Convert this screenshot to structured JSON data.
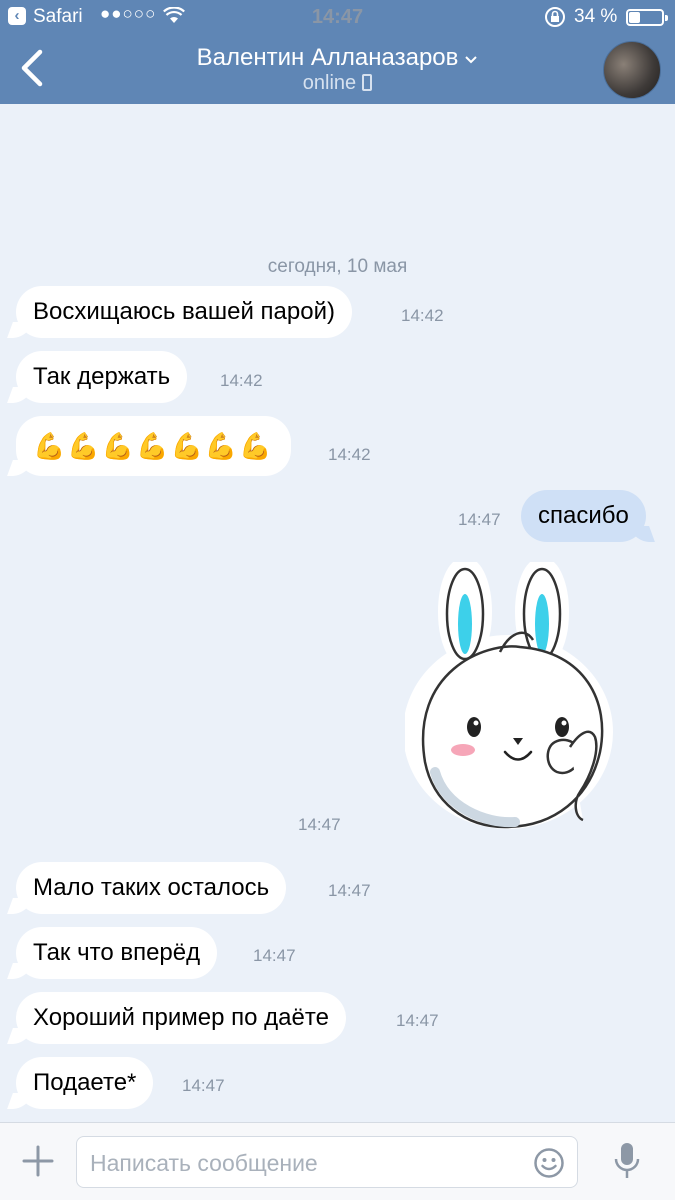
{
  "status_bar": {
    "back_app": "Safari",
    "signal": "●●○○○",
    "time": "14:47",
    "battery_percent": "34 %",
    "battery_level": 0.34
  },
  "header": {
    "back_icon": "chevron-left-icon",
    "title": "Валентин Алланазаров",
    "subtitle": "online",
    "title_chevron": "chevron-down-icon",
    "avatar_icon": "avatar"
  },
  "chat": {
    "date_separator": "сегодня, 10 мая",
    "messages": [
      {
        "text": "Восхищаюсь вашей парой)",
        "time": "14:42",
        "direction": "in"
      },
      {
        "text": "Так держать",
        "time": "14:42",
        "direction": "in"
      },
      {
        "text": "💪💪💪💪💪💪💪",
        "time": "14:42",
        "direction": "in"
      },
      {
        "text": "спасибо",
        "time": "14:47",
        "direction": "out"
      },
      {
        "sticker": "bunny-ok-sticker",
        "time": "14:47",
        "direction": "out"
      },
      {
        "text": "Мало таких осталось",
        "time": "14:47",
        "direction": "in"
      },
      {
        "text": "Так что вперёд",
        "time": "14:47",
        "direction": "in"
      },
      {
        "text": "Хороший пример по даёте",
        "time": "14:47",
        "direction": "in"
      },
      {
        "text": "Подаете*",
        "time": "14:47",
        "direction": "in"
      }
    ]
  },
  "composer": {
    "placeholder": "Написать сообщение",
    "value": "",
    "attach_icon": "plus-icon",
    "emoji_icon": "smile-icon",
    "voice_icon": "microphone-icon"
  },
  "colors": {
    "header_bg": "#5f86b5",
    "chat_bg": "#ebf1f9",
    "incoming_bubble": "#ffffff",
    "outgoing_bubble": "#cfe0f6"
  }
}
